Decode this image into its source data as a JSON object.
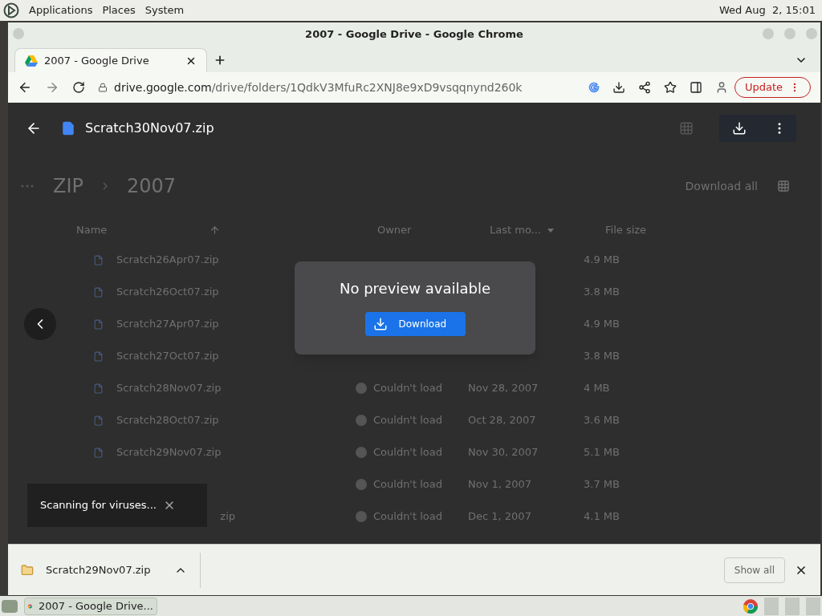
{
  "top_panel": {
    "menus": [
      "Applications",
      "Places",
      "System"
    ],
    "clock": "Wed Aug  2, 15:01"
  },
  "window": {
    "title": "2007 - Google Drive - Google Chrome"
  },
  "tabs": [
    {
      "label": "2007 - Google Drive",
      "selected": true
    }
  ],
  "address_bar": {
    "host": "drive.google.com",
    "path": "/drive/folders/1QdkV3MfuRc2XNJ8e9xD9vsqqnynd260k"
  },
  "update_button": "Update",
  "drive": {
    "breadcrumb": [
      "ZIP",
      "2007"
    ],
    "download_all": "Download all",
    "columns": [
      "Name",
      "Owner",
      "Last mo...",
      "File size"
    ],
    "rows": [
      {
        "name": "Scratch26Apr07.zip",
        "size": "4.9 MB"
      },
      {
        "name": "Scratch26Oct07.zip",
        "size": "3.8 MB"
      },
      {
        "name": "Scratch27Apr07.zip",
        "size": "4.9 MB"
      },
      {
        "name": "Scratch27Oct07.zip",
        "size": "3.8 MB"
      },
      {
        "name": "Scratch28Nov07.zip",
        "owner": "Couldn't load",
        "modified": "Nov 28, 2007",
        "size": "4 MB"
      },
      {
        "name": "Scratch28Oct07.zip",
        "owner": "Couldn't load",
        "modified": "Oct 28, 2007",
        "size": "3.6 MB"
      },
      {
        "name": "Scratch29Nov07.zip",
        "owner": "Couldn't load",
        "modified": "Nov 30, 2007",
        "size": "5.1 MB"
      },
      {
        "owner": "Couldn't load",
        "modified": "Nov 1, 2007",
        "size": "3.7 MB"
      },
      {
        "name": "zip",
        "kind": "clipped",
        "owner": "Couldn't load",
        "modified": "Dec 1, 2007",
        "size": "4.1 MB"
      }
    ]
  },
  "viewer": {
    "file_name": "Scratch30Nov07.zip",
    "message": "No preview available",
    "download_button": "Download"
  },
  "toast": {
    "text": "Scanning for viruses..."
  },
  "download_shelf": {
    "file": "Scratch29Nov07.zip",
    "show_all": "Show all"
  },
  "taskbar": {
    "items": [
      {
        "label": "2007 - Google Drive...",
        "selected": true
      }
    ]
  }
}
